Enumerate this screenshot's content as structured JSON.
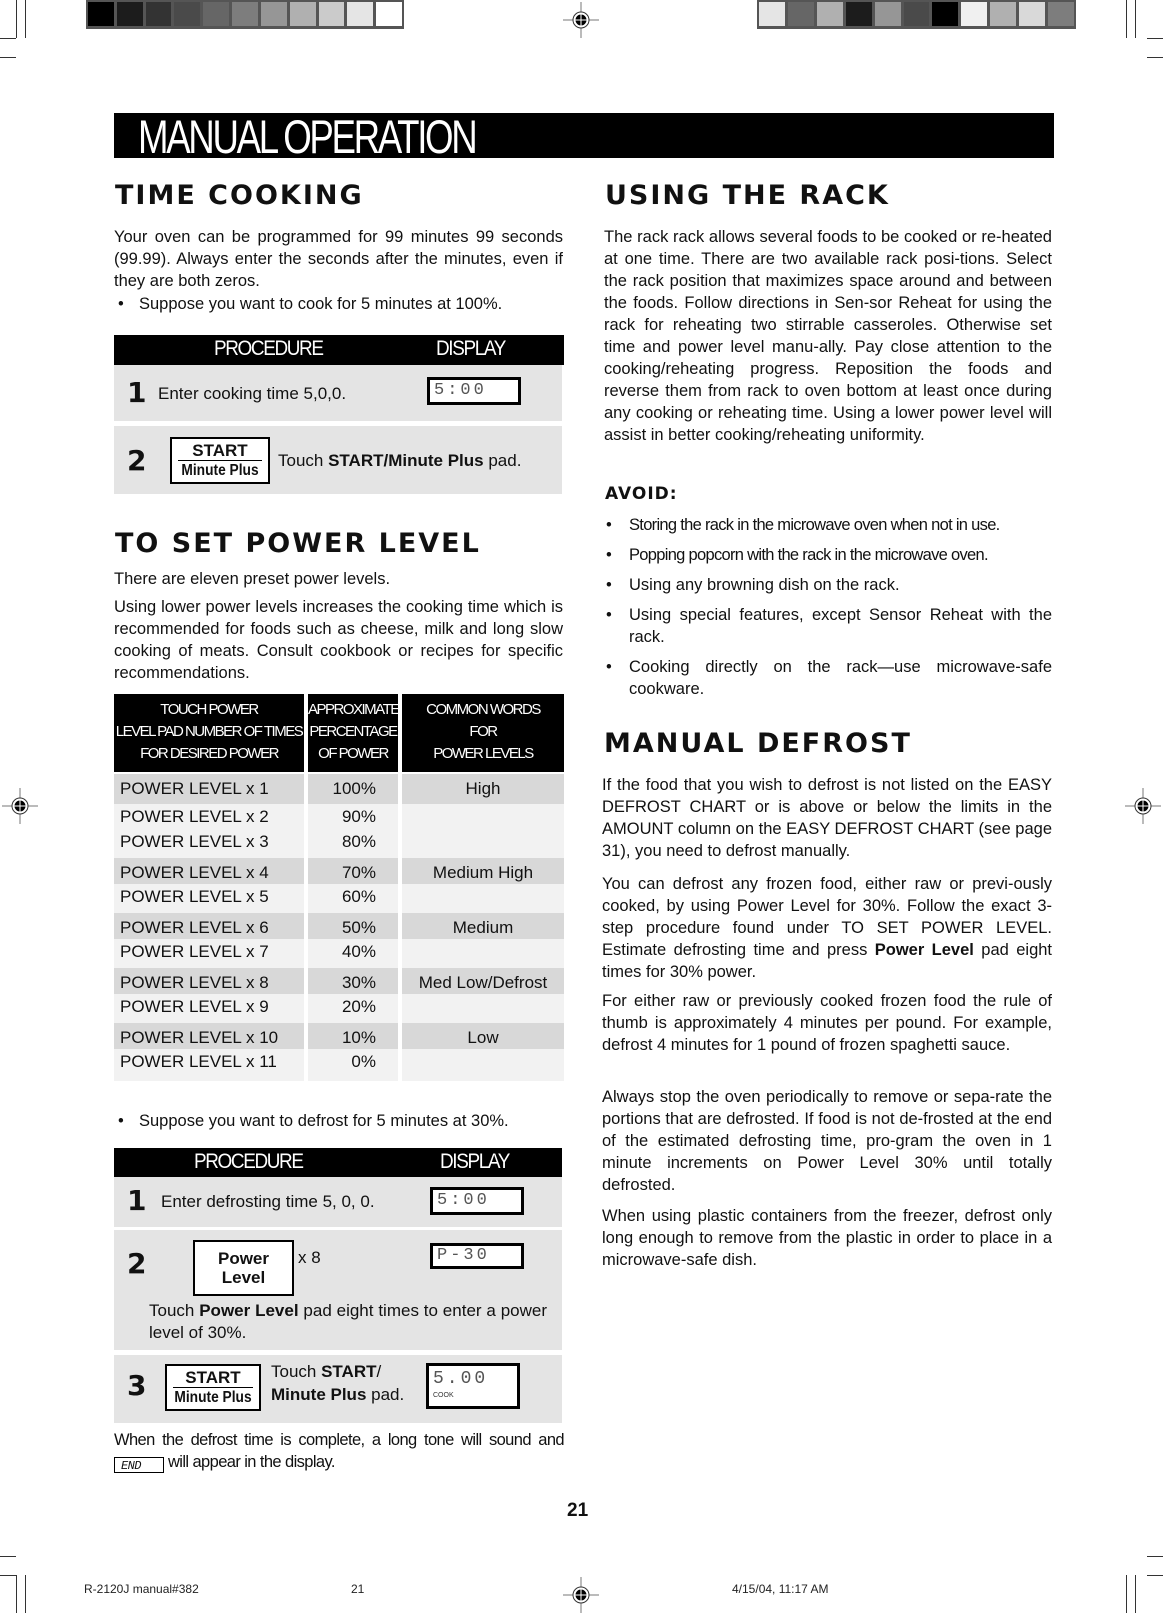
{
  "print_marks": {
    "left_colorbar": [
      "#000000",
      "#1c1c1c",
      "#333333",
      "#4a4a4a",
      "#666666",
      "#7d7d7d",
      "#969696",
      "#b0b0b0",
      "#cbcbcb",
      "#e5e5e5",
      "#ffffff"
    ],
    "right_colorbar": [
      "#e5e5e5",
      "#666666",
      "#b0b0b0",
      "#1c1c1c",
      "#969696",
      "#4a4a4a",
      "#000000",
      "#f0f0f0",
      "#b0b0b0",
      "#d9d9d9",
      "#7d7d7d"
    ]
  },
  "banner": {
    "title": "MANUAL OPERATION"
  },
  "time_cooking": {
    "heading": "TIME COOKING",
    "intro": "Your oven can be programmed for 99 minutes 99 seconds (99.99). Always enter the seconds after the minutes, even if they are both zeros.",
    "bullet": "Suppose you want to cook for 5 minutes at 100%.",
    "procedure_header": "PROCEDURE",
    "display_header": "DISPLAY",
    "steps": [
      {
        "num": "1",
        "text": "Enter cooking time 5,0,0.",
        "display": "5:00"
      },
      {
        "num": "2",
        "pad_top": "START",
        "pad_bottom": "Minute Plus",
        "text_pre": "Touch ",
        "text_bold": "START/Minute Plus",
        "text_post": " pad."
      }
    ]
  },
  "power_level": {
    "heading": "TO SET POWER LEVEL",
    "intro1": "There are eleven preset power levels.",
    "intro2": "Using lower power levels increases the cooking time which is recommended for foods such as cheese, milk and long slow cooking of meats. Consult cookbook or recipes for specific recommendations.",
    "table": {
      "headers": [
        [
          "TOUCH POWER",
          "LEVEL PAD NUMBER OF TIMES",
          "FOR DESIRED POWER"
        ],
        [
          "APPROXIMATE",
          "PERCENTAGE",
          "OF POWER"
        ],
        [
          "COMMON WORDS",
          "FOR",
          "POWER LEVELS"
        ]
      ],
      "rows": [
        {
          "pad": "POWER LEVEL x 1",
          "percent": "100%",
          "word": "High"
        },
        {
          "pad": "POWER LEVEL x 2",
          "percent": "90%",
          "word": ""
        },
        {
          "pad": "POWER LEVEL x 3",
          "percent": "80%",
          "word": ""
        },
        {
          "pad": "POWER LEVEL x 4",
          "percent": "70%",
          "word": "Medium High"
        },
        {
          "pad": "POWER LEVEL x 5",
          "percent": "60%",
          "word": ""
        },
        {
          "pad": "POWER LEVEL x 6",
          "percent": "50%",
          "word": "Medium"
        },
        {
          "pad": "POWER LEVEL x 7",
          "percent": "40%",
          "word": ""
        },
        {
          "pad": "POWER LEVEL x 8",
          "percent": "30%",
          "word": "Med Low/Defrost"
        },
        {
          "pad": "POWER LEVEL x 9",
          "percent": "20%",
          "word": ""
        },
        {
          "pad": "POWER LEVEL x 10",
          "percent": "10%",
          "word": "Low"
        },
        {
          "pad": "POWER LEVEL x 11",
          "percent": "0%",
          "word": ""
        }
      ]
    },
    "bullet": "Suppose you want to defrost for 5 minutes at 30%.",
    "procedure_header": "PROCEDURE",
    "display_header": "DISPLAY",
    "steps": [
      {
        "num": "1",
        "text": "Enter defrosting time 5, 0, 0.",
        "display": "5:00"
      },
      {
        "num": "2",
        "pad_top": "Power",
        "pad_bottom": "Level",
        "times": "x 8",
        "display": "P-30",
        "desc_pre": "Touch ",
        "desc_bold": "Power Level",
        "desc_post": " pad eight times to enter a power level of 30%."
      },
      {
        "num": "3",
        "pad_top": "START",
        "pad_bottom": "Minute Plus",
        "text_line1_pre": "Touch ",
        "text_line1_bold": "START",
        "text_line1_post": "/",
        "text_line2_bold": "Minute Plus",
        "text_line2_post": " pad.",
        "display": "5.00",
        "display_sub": "COOK"
      }
    ],
    "closing_pre": "When the defrost time is complete, a long tone will sound and ",
    "closing_display": "END",
    "closing_post": " will appear in the display."
  },
  "rack": {
    "heading": "USING THE RACK",
    "body": "The rack rack allows several foods to be cooked or re-heated at one time. There are two available rack posi-tions. Select the rack position that maximizes space around and between the foods. Follow directions in Sen-sor Reheat for using the rack for reheating two stirrable casseroles. Otherwise set time and power level manu-ally. Pay close attention to the cooking/reheating progress. Reposition the foods and reverse them from rack to oven bottom at least once during any cooking or reheating time. Using a lower power level will assist in better cooking/reheating uniformity.",
    "avoid_heading": "AVOID:",
    "avoid_items": [
      "Storing the rack in the microwave oven when not in use.",
      "Popping popcorn with the rack in the microwave oven.",
      "Using any browning dish on the rack.",
      "Using special features, except Sensor Reheat with the rack.",
      "Cooking directly on the rack—use microwave-safe cookware."
    ]
  },
  "manual_defrost": {
    "heading": "MANUAL DEFROST",
    "p1": "If the food that you wish to defrost is not listed on the EASY DEFROST CHART or is above or below the limits in the AMOUNT column on the EASY DEFROST CHART (see page 31), you need to defrost manually.",
    "p2_pre": "You can defrost any frozen food, either raw or previ-ously cooked, by using Power Level for 30%. Follow the exact 3-step procedure found under TO SET POWER LEVEL. Estimate defrosting time and press ",
    "p2_bold": "Power Level",
    "p2_post": " pad eight times for 30% power.",
    "p3": "For either raw or previously cooked frozen food the rule of thumb is approximately 4 minutes per pound. For example, defrost 4 minutes for 1 pound of frozen spaghetti sauce.",
    "p4": "Always stop the oven periodically to remove or sepa-rate the portions that are defrosted. If food is not de-frosted at the end of the estimated defrosting time, pro-gram the oven in 1 minute increments on Power Level 30% until totally defrosted.",
    "p5": "When using plastic containers from the freezer, defrost only long enough to remove from the plastic in order to place in a microwave-safe dish."
  },
  "page_number": "21",
  "footer": {
    "file": "R-2120J manual#382",
    "page": "21",
    "timestamp": "4/15/04, 11:17 AM"
  }
}
